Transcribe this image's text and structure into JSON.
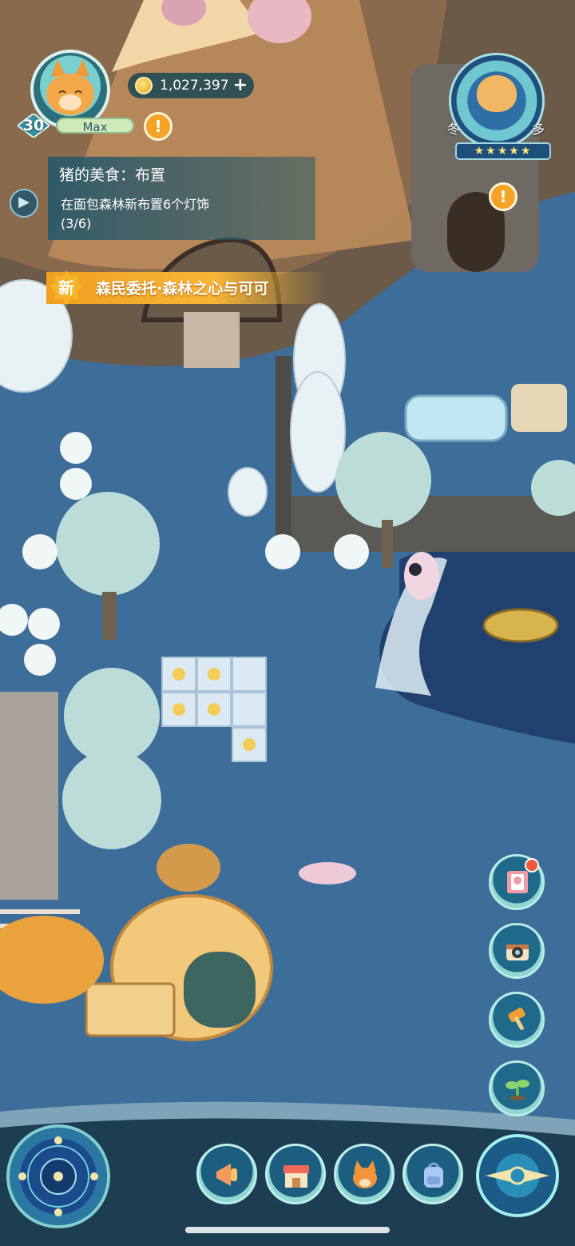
{
  "player": {
    "avatar_icon": "fox-avatar-icon",
    "level": "30",
    "level_label": "Max"
  },
  "currency": {
    "coins": "1,027,397",
    "add_symbol": "+"
  },
  "alerts": {
    "symbol": "!"
  },
  "quest": {
    "title": "猪的美食：布置",
    "description": "在面包森林新布置6个灯饰",
    "progress": "(3/6)"
  },
  "banner": {
    "new_tag": "新",
    "text": "森民委托·森林之心与可可"
  },
  "weather": {
    "season": "冬",
    "condition": "多云",
    "rating_stars": "★★★★★"
  },
  "side_buttons": [
    {
      "icon": "book-icon",
      "has_notification": true
    },
    {
      "icon": "camera-icon",
      "has_notification": false
    },
    {
      "icon": "hammer-icon",
      "has_notification": false
    },
    {
      "icon": "sprout-icon",
      "has_notification": false
    }
  ],
  "bottom_buttons": [
    {
      "icon": "megaphone-icon"
    },
    {
      "icon": "shop-icon"
    },
    {
      "icon": "fox-icon"
    },
    {
      "icon": "backpack-icon"
    }
  ],
  "colors": {
    "accent_orange": "#f5a326",
    "panel_teal": "#28586a",
    "water_blue": "#3b6b96"
  }
}
